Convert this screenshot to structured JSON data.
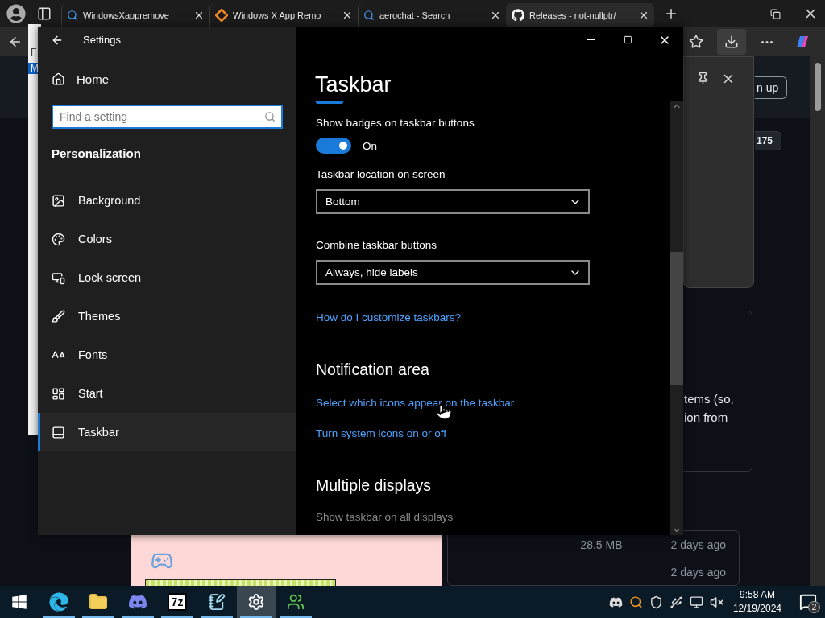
{
  "browser": {
    "tabs": [
      {
        "kind": "search",
        "title": "WindowsXappremove",
        "selected": false
      },
      {
        "kind": "app",
        "title": "Windows X App Remo",
        "selected": false
      },
      {
        "kind": "search",
        "title": "aerochat - Search",
        "selected": false
      },
      {
        "kind": "github",
        "title": "Releases - not-nullptr/",
        "selected": true
      }
    ],
    "page": {
      "sign_up": "n up",
      "badge": "175",
      "text_lines": [
        "tems (so,",
        "ion from"
      ],
      "rows": [
        {
          "size": "28.5 MB",
          "age": "2 days ago"
        },
        {
          "age": "2 days ago"
        }
      ]
    },
    "side_window": {
      "lines": [
        "F",
        "M"
      ]
    }
  },
  "settings": {
    "title": "Settings",
    "home": "Home",
    "search": {
      "placeholder": "Find a setting"
    },
    "section": "Personalization",
    "nav": [
      {
        "kind": "background",
        "label": "Background",
        "selected": false
      },
      {
        "kind": "colors",
        "label": "Colors",
        "selected": false
      },
      {
        "kind": "lock",
        "label": "Lock screen",
        "selected": false
      },
      {
        "kind": "themes",
        "label": "Themes",
        "selected": false
      },
      {
        "kind": "fonts",
        "label": "Fonts",
        "selected": false
      },
      {
        "kind": "start",
        "label": "Start",
        "selected": false
      },
      {
        "kind": "taskbar",
        "label": "Taskbar",
        "selected": true
      }
    ],
    "page_title": "Taskbar",
    "content": [
      {
        "kind": "label",
        "text": "Show badges on taskbar buttons",
        "disabled": false
      },
      {
        "kind": "toggle",
        "text": "On",
        "on": true
      },
      {
        "kind": "label",
        "text": "Taskbar location on screen",
        "disabled": false
      },
      {
        "kind": "dropdown",
        "text": "Bottom"
      },
      {
        "kind": "label",
        "text": "Combine taskbar buttons",
        "disabled": false
      },
      {
        "kind": "dropdown",
        "text": "Always, hide labels"
      },
      {
        "kind": "link",
        "text": "How do I customize taskbars?"
      },
      {
        "kind": "heading",
        "text": "Notification area"
      },
      {
        "kind": "link",
        "text": "Select which icons appear on the taskbar"
      },
      {
        "kind": "link",
        "text": "Turn system icons on or off"
      },
      {
        "kind": "heading",
        "text": "Multiple displays"
      },
      {
        "kind": "label",
        "text": "Show taskbar on all displays",
        "disabled": true
      }
    ]
  },
  "taskbar": {
    "apps": [
      {
        "kind": "edge",
        "running": true,
        "selected": false
      },
      {
        "kind": "explorer",
        "running": true,
        "selected": false
      },
      {
        "kind": "discord",
        "running": true,
        "selected": false
      },
      {
        "kind": "archiver",
        "label": "7z",
        "running": true,
        "selected": false
      },
      {
        "kind": "notepad",
        "running": true,
        "selected": false
      },
      {
        "kind": "settings",
        "running": true,
        "selected": true
      },
      {
        "kind": "messenger",
        "running": true,
        "selected": false
      }
    ],
    "time": "9:58 AM",
    "date": "12/19/2024",
    "notifications": "2"
  }
}
